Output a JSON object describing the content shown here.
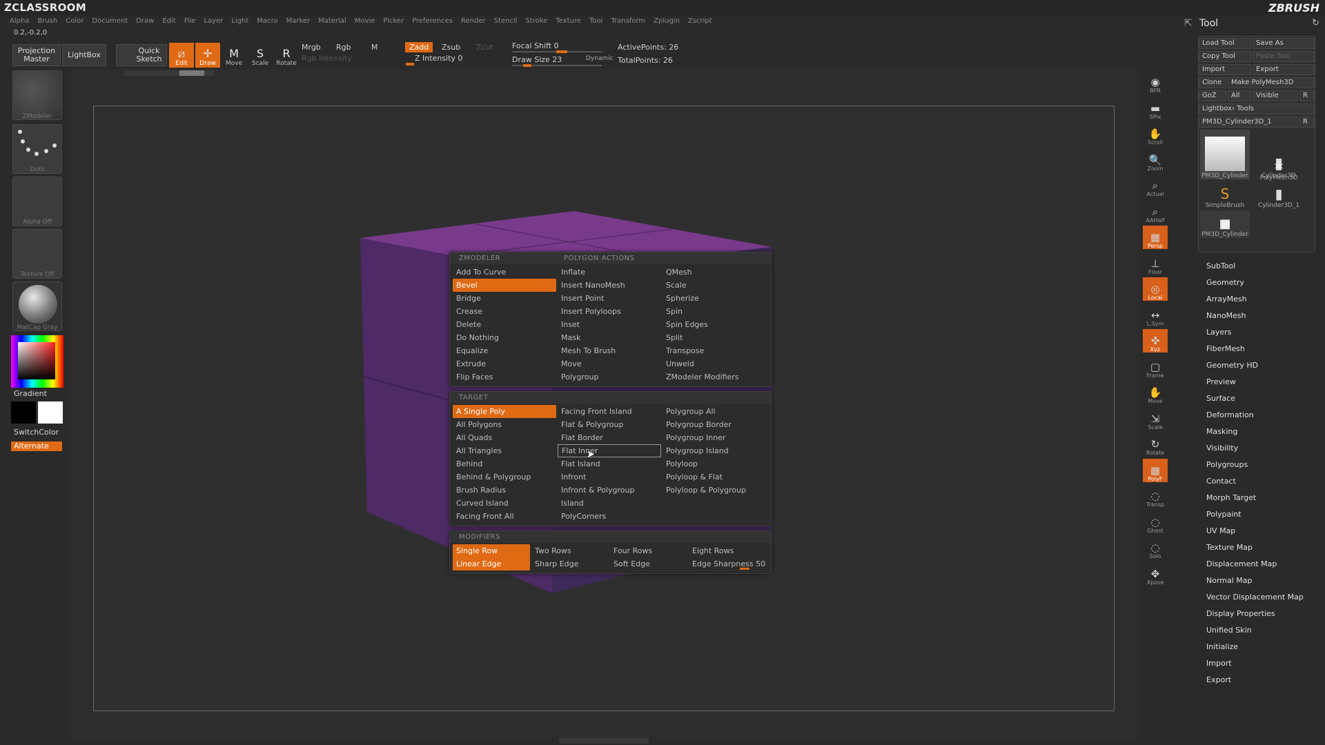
{
  "app": {
    "brand_left": "ZCLASSROOM",
    "brand_right": "ZBRUSH"
  },
  "menu": [
    "Alpha",
    "Brush",
    "Color",
    "Document",
    "Draw",
    "Edit",
    "File",
    "Layer",
    "Light",
    "Macro",
    "Marker",
    "Material",
    "Movie",
    "Picker",
    "Preferences",
    "Render",
    "Stencil",
    "Stroke",
    "Texture",
    "Tool",
    "Transform",
    "Zplugin",
    "Zscript"
  ],
  "coords": "0.2,-0.2,0",
  "toolbar": {
    "projection_master": "Projection Master",
    "lightbox": "LightBox",
    "quick_sketch": "Quick Sketch",
    "edit": "Edit",
    "draw": "Draw",
    "move": "Move",
    "scale": "Scale",
    "rotate": "Rotate",
    "mrgb": "Mrgb",
    "rgb": "Rgb",
    "m": "M",
    "rgb_intensity": "Rgb Intensity",
    "zadd": "Zadd",
    "zsub": "Zsub",
    "zcut": "Zcut",
    "z_intensity": "Z Intensity 0",
    "focal_shift": "Focal Shift 0",
    "draw_size": "Draw Size 23",
    "dynamic": "Dynamic",
    "active_points": "ActivePoints: 26",
    "total_points": "TotalPoints: 26"
  },
  "left": {
    "zmodeler": "ZModeler",
    "dots": "Dots",
    "alpha_off": "Alpha Off",
    "texture_off": "Texture Off",
    "matcap": "MatCap Gray",
    "gradient": "Gradient",
    "switchcolor": "SwitchColor",
    "alternate": "Alternate"
  },
  "popup": {
    "header_left": "ZMODELER",
    "header_right": "POLYGON ACTIONS",
    "actions": [
      "Add To Curve",
      "Inflate",
      "QMesh",
      "Bevel",
      "Insert NanoMesh",
      "Scale",
      "Bridge",
      "Insert Point",
      "Spherize",
      "Crease",
      "Insert Polyloops",
      "Spin",
      "Delete",
      "Inset",
      "Spin Edges",
      "Do Nothing",
      "Mask",
      "Split",
      "Equalize",
      "Mesh To Brush",
      "Transpose",
      "Extrude",
      "Move",
      "Unweld",
      "Flip Faces",
      "Polygroup",
      "ZModeler Modifiers"
    ],
    "target_header": "TARGET",
    "targets": [
      "A Single Poly",
      "Facing Front Island",
      "Polygroup All",
      "All Polygons",
      "Flat & Polygroup",
      "Polygroup Border",
      "All Quads",
      "Flat Border",
      "Polygroup Inner",
      "All Triangles",
      "Flat Inner",
      "Polygroup Island",
      "Behind",
      "Flat Island",
      "Polyloop",
      "Behind & Polygroup",
      "Infront",
      "Polyloop & Flat",
      "Brush Radius",
      "Infront & Polygroup",
      "Polyloop & Polygroup",
      "Curved Island",
      "Island",
      "",
      "Facing Front All",
      "PolyCorners",
      ""
    ],
    "modifiers_header": "MODIFIERS",
    "modifiers": [
      "Single Row",
      "Two Rows",
      "Four Rows",
      "Eight Rows",
      "Linear Edge",
      "Sharp Edge",
      "Soft Edge",
      "Edge Sharpness 50"
    ],
    "selected_action": "Bevel",
    "selected_target": "A Single Poly",
    "hovered_target": "Flat Inner",
    "edge_sharpness": 50
  },
  "rstrip": [
    "BPR",
    "SPix",
    "Scroll",
    "Zoom",
    "Actual",
    "AAHalf",
    "Persp",
    "Floor",
    "Local",
    "L.Sym",
    "Xyz",
    "Frame",
    "Move",
    "Scale",
    "Rotate",
    "PolyF",
    "Transp",
    "Ghost",
    "Solo",
    "Xpose"
  ],
  "tool": {
    "title": "Tool",
    "load_tool": "Load Tool",
    "save_as": "Save As",
    "copy_tool": "Copy Tool",
    "paste_tool": "Paste Tool",
    "import": "Import",
    "export": "Export",
    "clone": "Clone",
    "make_polymesh": "Make PolyMesh3D",
    "goz": "GoZ",
    "all": "All",
    "visible": "Visible",
    "r": "R",
    "lightbox_tools": "Lightbox› Tools",
    "current_tool": "PM3D_Cylinder3D_1",
    "thumbs": [
      "PM3D_Cylinder",
      "Cylinder3D",
      "PolyMesh3D",
      "SimpleBrush",
      "Cylinder3D_1",
      "PM3D_Cylinder"
    ],
    "sections": [
      "SubTool",
      "Geometry",
      "ArrayMesh",
      "NanoMesh",
      "Layers",
      "FiberMesh",
      "Geometry HD",
      "Preview",
      "Surface",
      "Deformation",
      "Masking",
      "Visibility",
      "Polygroups",
      "Contact",
      "Morph Target",
      "Polypaint",
      "UV Map",
      "Texture Map",
      "Displacement Map",
      "Normal Map",
      "Vector Displacement Map",
      "Display Properties",
      "Unified Skin",
      "Initialize",
      "Import",
      "Export"
    ]
  },
  "colors": {
    "accent": "#e06a14",
    "cube_top": "#7a3a8c",
    "cube_side": "#4e2a66"
  }
}
